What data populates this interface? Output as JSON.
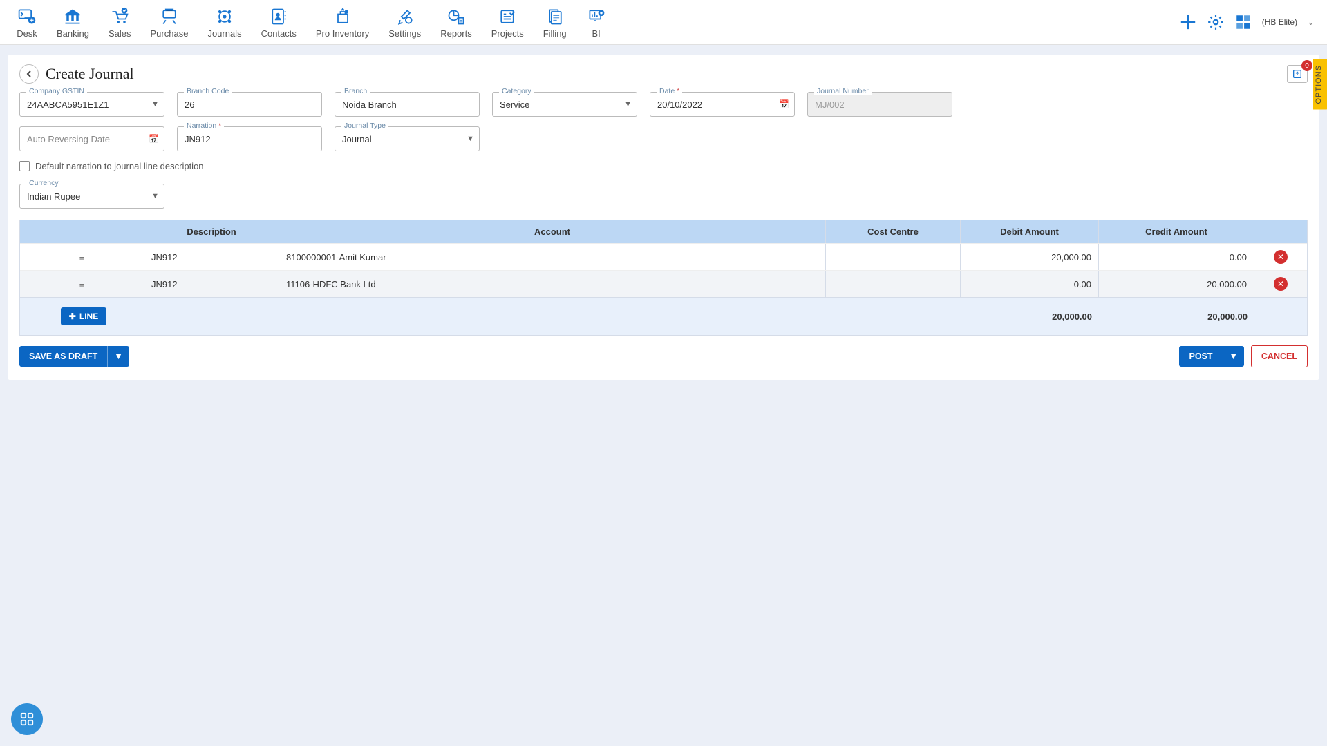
{
  "nav": {
    "items": [
      {
        "label": "Desk"
      },
      {
        "label": "Banking"
      },
      {
        "label": "Sales"
      },
      {
        "label": "Purchase"
      },
      {
        "label": "Journals"
      },
      {
        "label": "Contacts"
      },
      {
        "label": "Pro Inventory"
      },
      {
        "label": "Settings"
      },
      {
        "label": "Reports"
      },
      {
        "label": "Projects"
      },
      {
        "label": "Filling"
      },
      {
        "label": "BI"
      }
    ],
    "company": "(HB Elite)"
  },
  "page": {
    "title": "Create Journal",
    "import_badge": "0",
    "options_label": "OPTIONS"
  },
  "form": {
    "company_gstin": {
      "label": "Company GSTIN",
      "value": "24AABCA5951E1Z1"
    },
    "branch_code": {
      "label": "Branch Code",
      "value": "26"
    },
    "branch": {
      "label": "Branch",
      "value": "Noida Branch"
    },
    "category": {
      "label": "Category",
      "value": "Service"
    },
    "date": {
      "label": "Date",
      "value": "20/10/2022"
    },
    "journal_no": {
      "label": "Journal Number",
      "value": "MJ/002"
    },
    "auto_rev": {
      "label": "",
      "placeholder": "Auto Reversing Date",
      "value": ""
    },
    "narration": {
      "label": "Narration",
      "value": "JN912"
    },
    "journal_type": {
      "label": "Journal Type",
      "value": "Journal"
    },
    "default_narration_label": "Default narration to journal line description",
    "currency": {
      "label": "Currency",
      "value": "Indian Rupee"
    }
  },
  "table": {
    "headers": {
      "description": "Description",
      "account": "Account",
      "cost_centre": "Cost Centre",
      "debit": "Debit Amount",
      "credit": "Credit Amount"
    },
    "rows": [
      {
        "description": "JN912",
        "account": "8100000001-Amit Kumar",
        "cost_centre": "",
        "debit": "20,000.00",
        "credit": "0.00"
      },
      {
        "description": "JN912",
        "account": "11106-HDFC Bank Ltd",
        "cost_centre": "",
        "debit": "0.00",
        "credit": "20,000.00"
      }
    ],
    "line_btn": "LINE",
    "totals": {
      "debit": "20,000.00",
      "credit": "20,000.00"
    }
  },
  "actions": {
    "save_draft": "SAVE AS DRAFT",
    "post": "POST",
    "cancel": "CANCEL"
  }
}
